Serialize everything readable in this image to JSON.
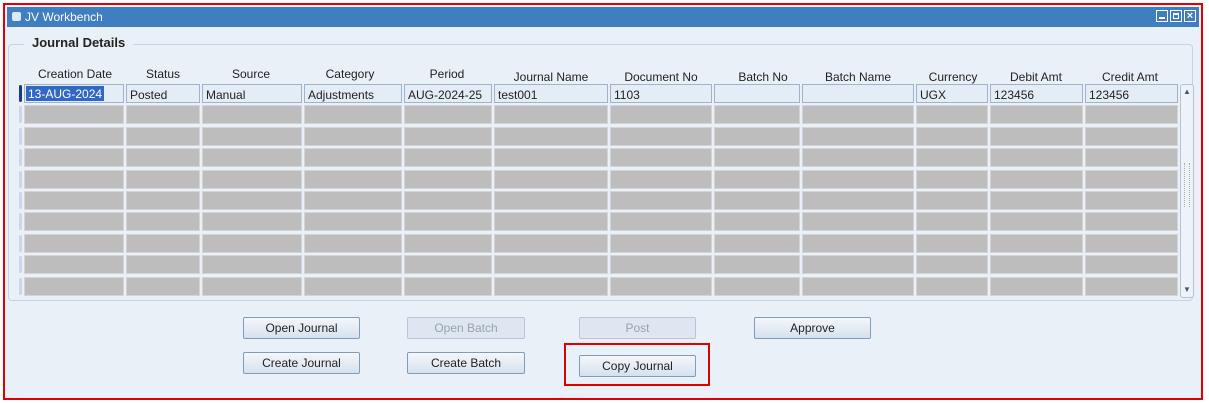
{
  "window": {
    "title": "JV Workbench"
  },
  "section": {
    "title": "Journal Details"
  },
  "columns": [
    {
      "key": "creation_date",
      "label": "Creation Date"
    },
    {
      "key": "status",
      "label": "Status"
    },
    {
      "key": "source",
      "label": "Source"
    },
    {
      "key": "category",
      "label": "Category"
    },
    {
      "key": "period",
      "label": "Period"
    },
    {
      "key": "journal_name",
      "label": "Journal Name"
    },
    {
      "key": "document_no",
      "label": "Document No"
    },
    {
      "key": "batch_no",
      "label": "Batch No"
    },
    {
      "key": "batch_name",
      "label": "Batch Name"
    },
    {
      "key": "currency",
      "label": "Currency"
    },
    {
      "key": "debit_amt",
      "label": "Debit Amt"
    },
    {
      "key": "credit_amt",
      "label": "Credit Amt"
    }
  ],
  "rows": [
    [
      "13-AUG-2024",
      "Posted",
      "Manual",
      "Adjustments",
      "AUG-2024-25",
      "test001",
      "1103",
      "",
      "",
      "UGX",
      "123456",
      "123456"
    ],
    [
      "",
      "",
      "",
      "",
      "",
      "",
      "",
      "",
      "",
      "",
      "",
      ""
    ],
    [
      "",
      "",
      "",
      "",
      "",
      "",
      "",
      "",
      "",
      "",
      "",
      ""
    ],
    [
      "",
      "",
      "",
      "",
      "",
      "",
      "",
      "",
      "",
      "",
      "",
      ""
    ],
    [
      "",
      "",
      "",
      "",
      "",
      "",
      "",
      "",
      "",
      "",
      "",
      ""
    ],
    [
      "",
      "",
      "",
      "",
      "",
      "",
      "",
      "",
      "",
      "",
      "",
      ""
    ],
    [
      "",
      "",
      "",
      "",
      "",
      "",
      "",
      "",
      "",
      "",
      "",
      ""
    ],
    [
      "",
      "",
      "",
      "",
      "",
      "",
      "",
      "",
      "",
      "",
      "",
      ""
    ],
    [
      "",
      "",
      "",
      "",
      "",
      "",
      "",
      "",
      "",
      "",
      "",
      ""
    ],
    [
      "",
      "",
      "",
      "",
      "",
      "",
      "",
      "",
      "",
      "",
      "",
      ""
    ]
  ],
  "buttons": {
    "open_journal": "Open Journal",
    "open_batch": "Open Batch",
    "post": "Post",
    "approve": "Approve",
    "create_journal": "Create Journal",
    "create_batch": "Create Batch",
    "copy_journal": "Copy Journal"
  },
  "colors": {
    "titlebar": "#3f7fc0",
    "selection": "#3068c4",
    "highlight": "#e00000"
  }
}
